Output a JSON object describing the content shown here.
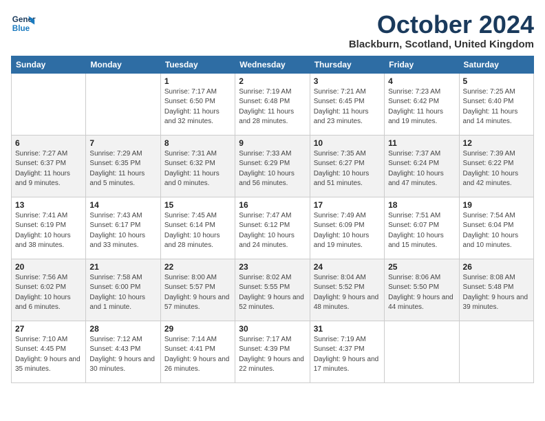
{
  "header": {
    "logo_line1": "General",
    "logo_line2": "Blue",
    "month_title": "October 2024",
    "location": "Blackburn, Scotland, United Kingdom"
  },
  "columns": [
    "Sunday",
    "Monday",
    "Tuesday",
    "Wednesday",
    "Thursday",
    "Friday",
    "Saturday"
  ],
  "weeks": [
    [
      {
        "day": "",
        "detail": ""
      },
      {
        "day": "",
        "detail": ""
      },
      {
        "day": "1",
        "detail": "Sunrise: 7:17 AM\nSunset: 6:50 PM\nDaylight: 11 hours and 32 minutes."
      },
      {
        "day": "2",
        "detail": "Sunrise: 7:19 AM\nSunset: 6:48 PM\nDaylight: 11 hours and 28 minutes."
      },
      {
        "day": "3",
        "detail": "Sunrise: 7:21 AM\nSunset: 6:45 PM\nDaylight: 11 hours and 23 minutes."
      },
      {
        "day": "4",
        "detail": "Sunrise: 7:23 AM\nSunset: 6:42 PM\nDaylight: 11 hours and 19 minutes."
      },
      {
        "day": "5",
        "detail": "Sunrise: 7:25 AM\nSunset: 6:40 PM\nDaylight: 11 hours and 14 minutes."
      }
    ],
    [
      {
        "day": "6",
        "detail": "Sunrise: 7:27 AM\nSunset: 6:37 PM\nDaylight: 11 hours and 9 minutes."
      },
      {
        "day": "7",
        "detail": "Sunrise: 7:29 AM\nSunset: 6:35 PM\nDaylight: 11 hours and 5 minutes."
      },
      {
        "day": "8",
        "detail": "Sunrise: 7:31 AM\nSunset: 6:32 PM\nDaylight: 11 hours and 0 minutes."
      },
      {
        "day": "9",
        "detail": "Sunrise: 7:33 AM\nSunset: 6:29 PM\nDaylight: 10 hours and 56 minutes."
      },
      {
        "day": "10",
        "detail": "Sunrise: 7:35 AM\nSunset: 6:27 PM\nDaylight: 10 hours and 51 minutes."
      },
      {
        "day": "11",
        "detail": "Sunrise: 7:37 AM\nSunset: 6:24 PM\nDaylight: 10 hours and 47 minutes."
      },
      {
        "day": "12",
        "detail": "Sunrise: 7:39 AM\nSunset: 6:22 PM\nDaylight: 10 hours and 42 minutes."
      }
    ],
    [
      {
        "day": "13",
        "detail": "Sunrise: 7:41 AM\nSunset: 6:19 PM\nDaylight: 10 hours and 38 minutes."
      },
      {
        "day": "14",
        "detail": "Sunrise: 7:43 AM\nSunset: 6:17 PM\nDaylight: 10 hours and 33 minutes."
      },
      {
        "day": "15",
        "detail": "Sunrise: 7:45 AM\nSunset: 6:14 PM\nDaylight: 10 hours and 28 minutes."
      },
      {
        "day": "16",
        "detail": "Sunrise: 7:47 AM\nSunset: 6:12 PM\nDaylight: 10 hours and 24 minutes."
      },
      {
        "day": "17",
        "detail": "Sunrise: 7:49 AM\nSunset: 6:09 PM\nDaylight: 10 hours and 19 minutes."
      },
      {
        "day": "18",
        "detail": "Sunrise: 7:51 AM\nSunset: 6:07 PM\nDaylight: 10 hours and 15 minutes."
      },
      {
        "day": "19",
        "detail": "Sunrise: 7:54 AM\nSunset: 6:04 PM\nDaylight: 10 hours and 10 minutes."
      }
    ],
    [
      {
        "day": "20",
        "detail": "Sunrise: 7:56 AM\nSunset: 6:02 PM\nDaylight: 10 hours and 6 minutes."
      },
      {
        "day": "21",
        "detail": "Sunrise: 7:58 AM\nSunset: 6:00 PM\nDaylight: 10 hours and 1 minute."
      },
      {
        "day": "22",
        "detail": "Sunrise: 8:00 AM\nSunset: 5:57 PM\nDaylight: 9 hours and 57 minutes."
      },
      {
        "day": "23",
        "detail": "Sunrise: 8:02 AM\nSunset: 5:55 PM\nDaylight: 9 hours and 52 minutes."
      },
      {
        "day": "24",
        "detail": "Sunrise: 8:04 AM\nSunset: 5:52 PM\nDaylight: 9 hours and 48 minutes."
      },
      {
        "day": "25",
        "detail": "Sunrise: 8:06 AM\nSunset: 5:50 PM\nDaylight: 9 hours and 44 minutes."
      },
      {
        "day": "26",
        "detail": "Sunrise: 8:08 AM\nSunset: 5:48 PM\nDaylight: 9 hours and 39 minutes."
      }
    ],
    [
      {
        "day": "27",
        "detail": "Sunrise: 7:10 AM\nSunset: 4:45 PM\nDaylight: 9 hours and 35 minutes."
      },
      {
        "day": "28",
        "detail": "Sunrise: 7:12 AM\nSunset: 4:43 PM\nDaylight: 9 hours and 30 minutes."
      },
      {
        "day": "29",
        "detail": "Sunrise: 7:14 AM\nSunset: 4:41 PM\nDaylight: 9 hours and 26 minutes."
      },
      {
        "day": "30",
        "detail": "Sunrise: 7:17 AM\nSunset: 4:39 PM\nDaylight: 9 hours and 22 minutes."
      },
      {
        "day": "31",
        "detail": "Sunrise: 7:19 AM\nSunset: 4:37 PM\nDaylight: 9 hours and 17 minutes."
      },
      {
        "day": "",
        "detail": ""
      },
      {
        "day": "",
        "detail": ""
      }
    ]
  ]
}
